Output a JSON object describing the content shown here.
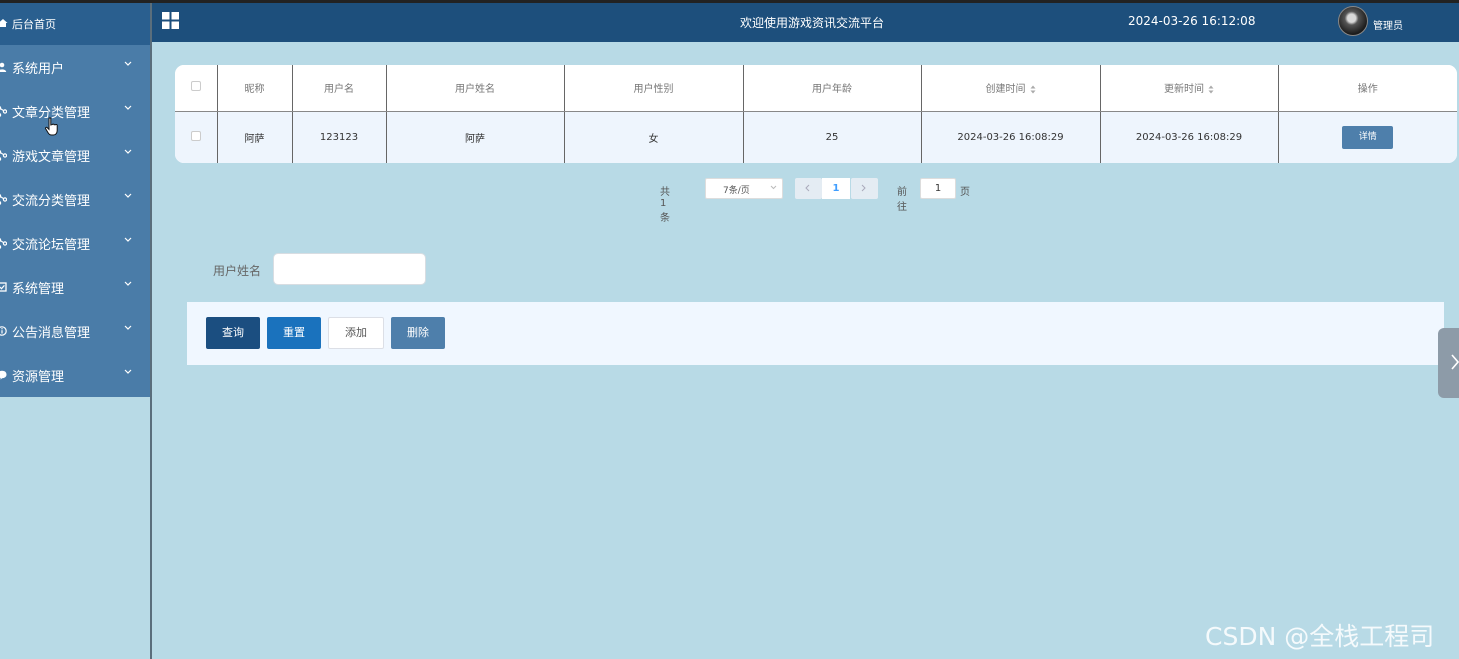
{
  "sidebar": {
    "home_label": "后台首页",
    "items": [
      {
        "label": "系统用户",
        "icon": "user-icon"
      },
      {
        "label": "文章分类管理",
        "icon": "share-icon"
      },
      {
        "label": "游戏文章管理",
        "icon": "share-icon"
      },
      {
        "label": "交流分类管理",
        "icon": "share-icon"
      },
      {
        "label": "交流论坛管理",
        "icon": "share-icon"
      },
      {
        "label": "系统管理",
        "icon": "checkbox-icon"
      },
      {
        "label": "公告消息管理",
        "icon": "info-icon"
      },
      {
        "label": "资源管理",
        "icon": "chat-icon"
      }
    ]
  },
  "header": {
    "title": "欢迎使用游戏资讯交流平台",
    "datetime": "2024-03-26 16:12:08",
    "user": "管理员"
  },
  "table": {
    "columns": [
      "昵称",
      "用户名",
      "用户姓名",
      "用户性别",
      "用户年龄",
      "创建时间",
      "更新时间",
      "操作"
    ],
    "rows": [
      {
        "nickname": "阿萨",
        "username": "123123",
        "realname": "阿萨",
        "gender": "女",
        "age": "25",
        "created": "2024-03-26 16:08:29",
        "updated": "2024-03-26 16:08:29",
        "action": "详情"
      }
    ]
  },
  "pagination": {
    "total": "共 1 条",
    "page_size": "7条/页",
    "current_page": "1",
    "goto_label": "前往",
    "goto_value": "1",
    "page_suffix": "页"
  },
  "search": {
    "label": "用户姓名",
    "value": ""
  },
  "actions": {
    "query": "查询",
    "reset": "重置",
    "add": "添加",
    "delete": "删除"
  },
  "watermark": "CSDN @全栈工程司",
  "colors": {
    "header_bg": "#1d4f7c",
    "sidebar_menu_bg": "#4a7ca8",
    "page_bg": "#b8dae6",
    "primary_dark": "#1b4e80",
    "primary": "#1a72bd",
    "muted_button": "#4e7fab"
  }
}
